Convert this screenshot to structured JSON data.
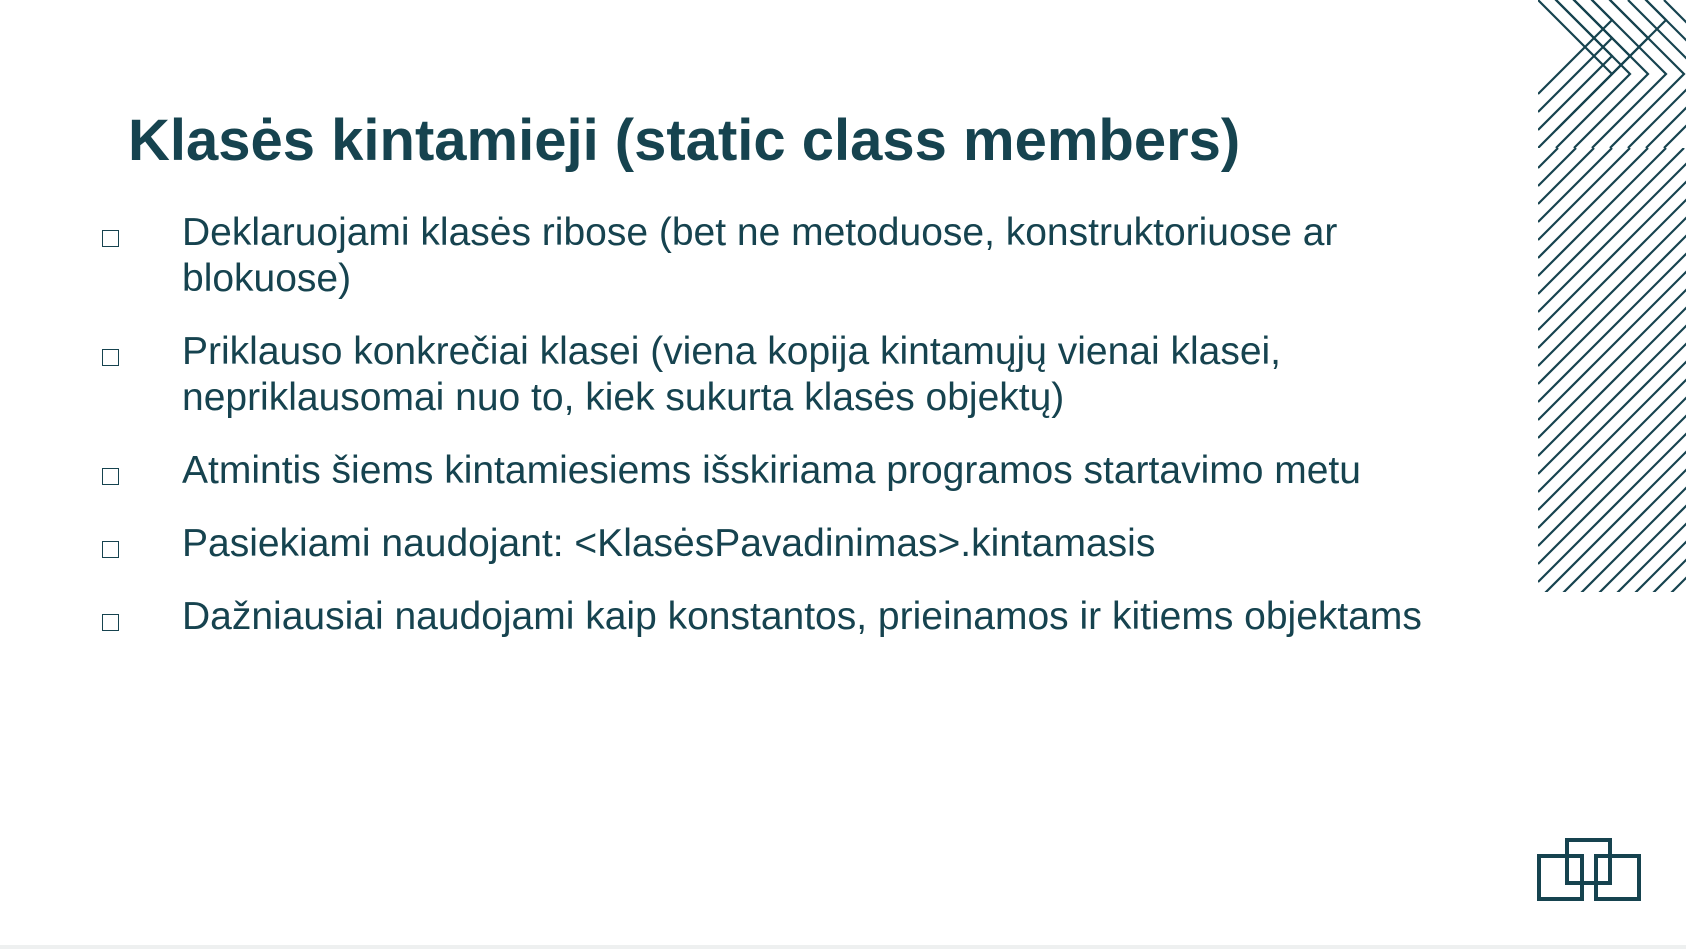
{
  "slide": {
    "title": "Klasės kintamieji (static class members)",
    "bullets": [
      "Deklaruojami klasės ribose (bet ne metoduose, konstruktoriuose ar blokuose)",
      "Priklauso konkrečiai klasei (viena kopija kintamųjų vienai klasei, nepriklausomai nuo to, kiek sukurta klasės objektų)",
      "Atmintis šiems kintamiesiems išskiriama programos startavimo metu",
      "Pasiekiami naudojant: <KlasėsPavadinimas>.kintamasis",
      "Dažniausiai naudojami kaip konstantos, prieinamos ir kitiems objektams"
    ],
    "bullet_icon": "square-outline-icon",
    "decoration_icon": "diagonal-lines-pattern-icon",
    "logo_icon": "overlapping-squares-logo-icon"
  },
  "colors": {
    "text": "#16434f",
    "background": "#ffffff"
  }
}
